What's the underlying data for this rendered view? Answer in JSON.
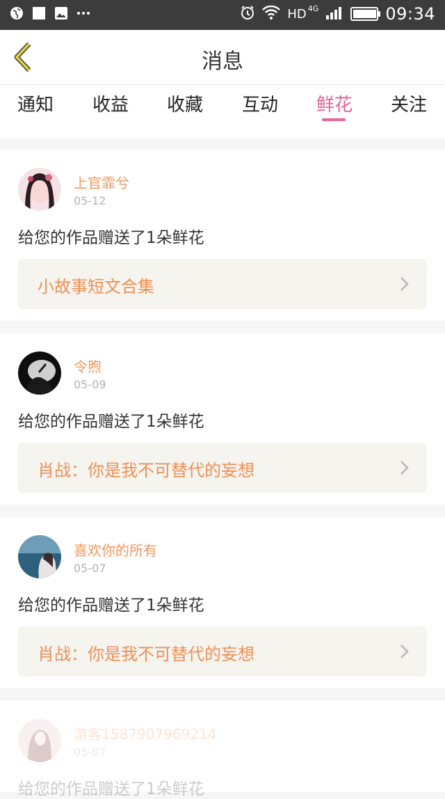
{
  "status_bar": {
    "network": "HD",
    "network_gen": "4G",
    "time": "09:34"
  },
  "header": {
    "title": "消息"
  },
  "tabs": [
    {
      "label": "通知"
    },
    {
      "label": "收益"
    },
    {
      "label": "收藏"
    },
    {
      "label": "互动"
    },
    {
      "label": "鲜花",
      "active": true
    },
    {
      "label": "关注"
    }
  ],
  "messages": [
    {
      "name": "上官霏兮",
      "date": "05-12",
      "text": "给您的作品赠送了1朵鲜花",
      "work": "小故事短文合集"
    },
    {
      "name": "令煦",
      "date": "05-09",
      "text": "给您的作品赠送了1朵鲜花",
      "work": "肖战：你是我不可替代的妄想"
    },
    {
      "name": "喜欢你的所有",
      "date": "05-07",
      "text": "给您的作品赠送了1朵鲜花",
      "work": "肖战：你是我不可替代的妄想"
    },
    {
      "name": "游客1587907969214",
      "date": "05-07",
      "text": "给您的作品赠送了1朵鲜花"
    }
  ],
  "colors": {
    "accent": "#e8629a",
    "name": "#f0975e",
    "work_bg": "#f5f4ee"
  }
}
